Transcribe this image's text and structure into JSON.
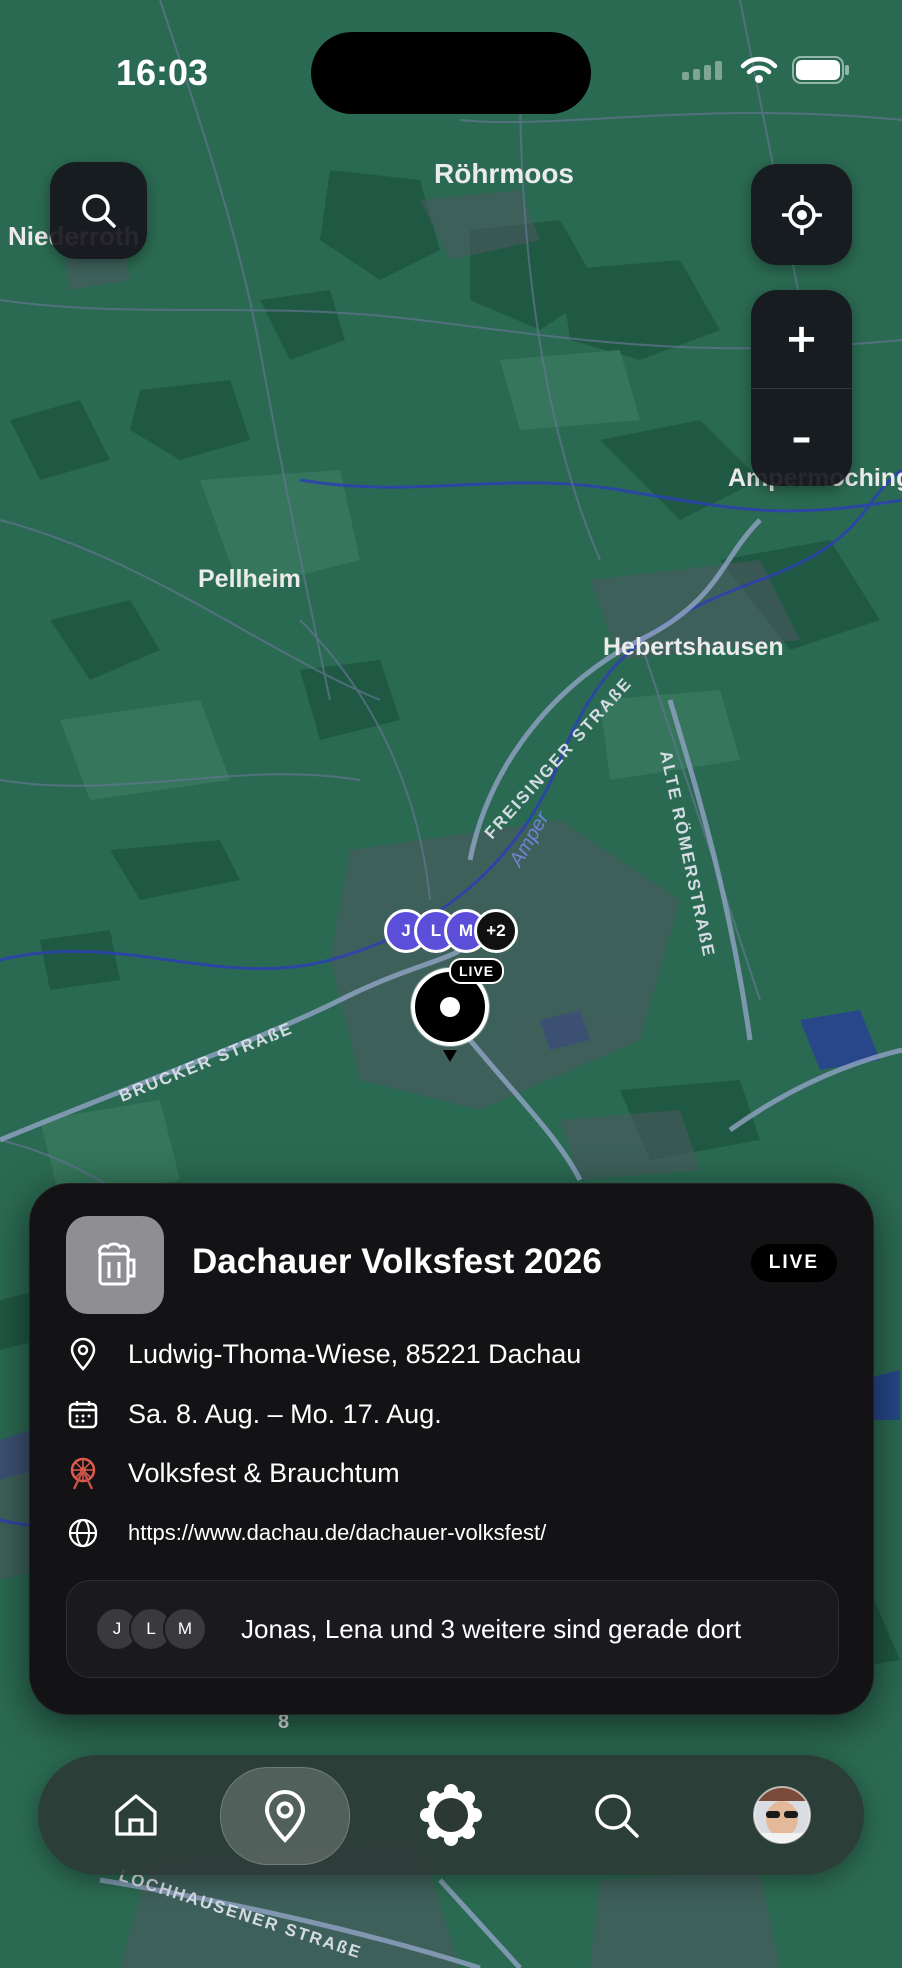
{
  "status": {
    "time": "16:03"
  },
  "map": {
    "labels": {
      "roehrmoos": "Röhrmoos",
      "niederroth": "Niederroth",
      "pellheim": "Pellheim",
      "hebertshausen": "Hebertshausen",
      "ampermoching": "Ampermoching",
      "freisinger": "FREISINGER STRAßE",
      "amper": "Amper",
      "alte_roemer": "ALTE RÖMERSTRAßE",
      "brucker": "BRUCKER STRAßE",
      "lochhausener": "LOCHHAUSENER STRAßE",
      "road_number": "8"
    },
    "cluster": {
      "avatars": [
        "J",
        "L",
        "M"
      ],
      "more": "+2",
      "live": "LIVE"
    }
  },
  "controls": {
    "zoom_in": "+",
    "zoom_out": "–"
  },
  "event": {
    "title": "Dachauer Volksfest 2026",
    "badge": "LIVE",
    "address": "Ludwig-Thoma-Wiese, 85221 Dachau",
    "dates": "Sa. 8. Aug. – Mo. 17. Aug.",
    "category": "Volksfest & Brauchtum",
    "url": "https://www.dachau.de/dachauer-volksfest/",
    "presence": {
      "avatars": [
        "J",
        "L",
        "M"
      ],
      "text": "Jonas, Lena und 3 weitere sind gerade dort"
    }
  },
  "tabbar": {
    "tabs": [
      {
        "icon": "home-icon"
      },
      {
        "icon": "map-pin-icon",
        "active": true
      },
      {
        "icon": "circle-badge-icon"
      },
      {
        "icon": "search-icon"
      },
      {
        "icon": "profile-avatar"
      }
    ]
  },
  "colors": {
    "map_green": "#2f7459",
    "card_bg": "#131316",
    "cluster_purple": "#5b4fd9"
  }
}
